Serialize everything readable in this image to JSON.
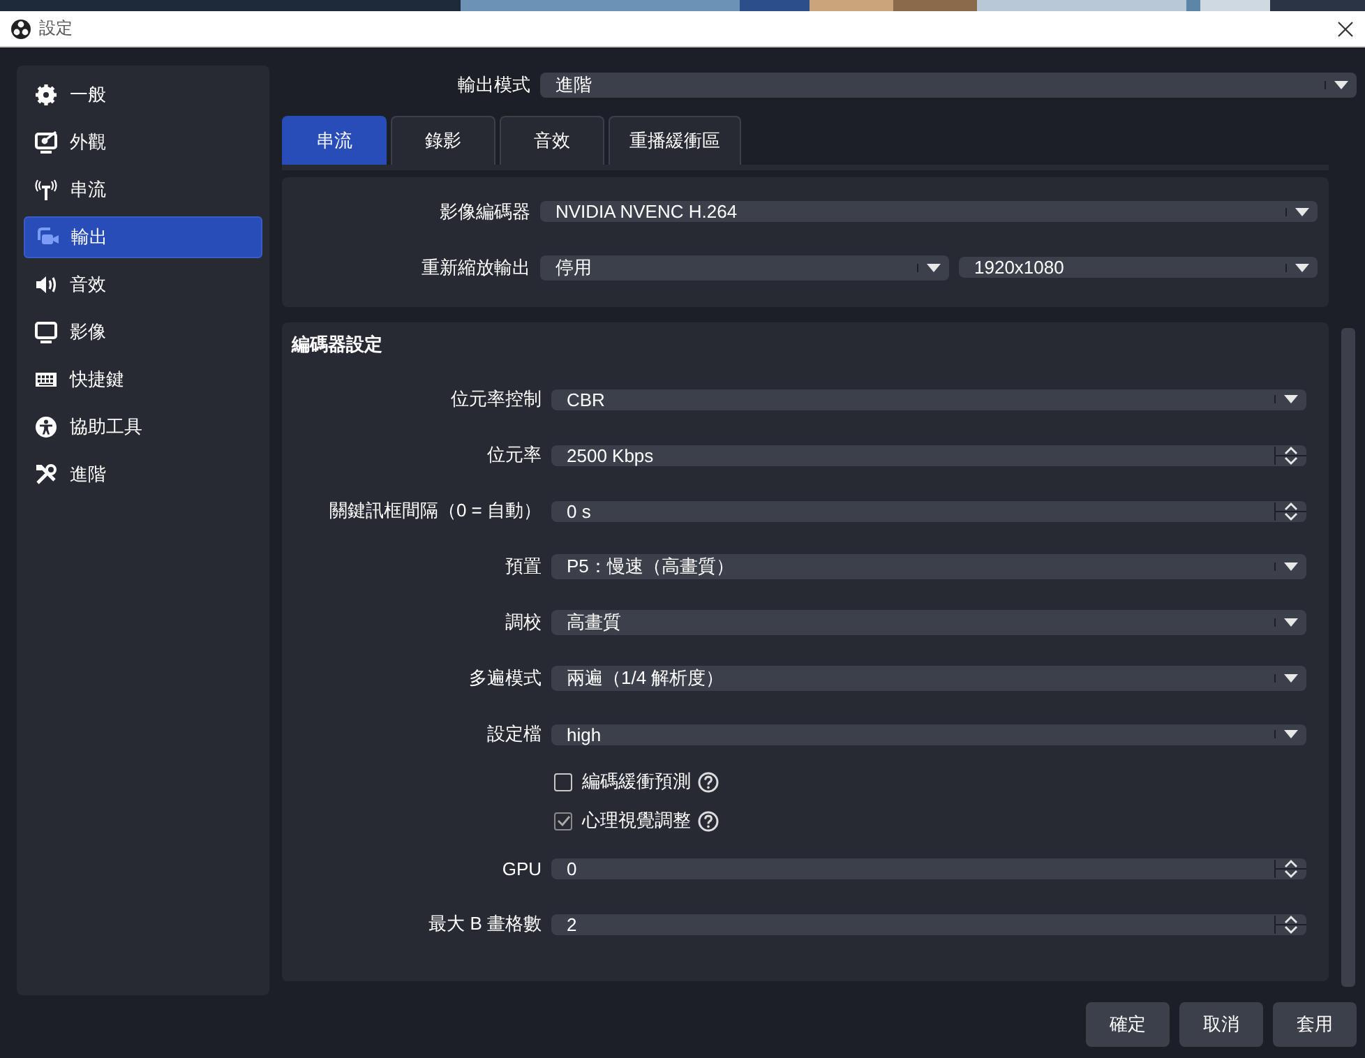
{
  "window": {
    "title": "設定"
  },
  "sidebar": {
    "items": [
      {
        "label": "一般",
        "kind": "gear",
        "selected": false
      },
      {
        "label": "外觀",
        "kind": "monitor-pen",
        "selected": false
      },
      {
        "label": "串流",
        "kind": "antenna",
        "selected": false
      },
      {
        "label": "輸出",
        "kind": "camera",
        "selected": true
      },
      {
        "label": "音效",
        "kind": "speaker",
        "selected": false
      },
      {
        "label": "影像",
        "kind": "monitor",
        "selected": false
      },
      {
        "label": "快捷鍵",
        "kind": "keyboard",
        "selected": false
      },
      {
        "label": "協助工具",
        "kind": "person",
        "selected": false
      },
      {
        "label": "進階",
        "kind": "tools",
        "selected": false
      }
    ]
  },
  "output_mode": {
    "label": "輸出模式",
    "value": "進階"
  },
  "tabs": [
    {
      "label": "串流",
      "selected": true
    },
    {
      "label": "錄影",
      "selected": false
    },
    {
      "label": "音效",
      "selected": false
    },
    {
      "label": "重播緩衝區",
      "selected": false
    }
  ],
  "encoder": {
    "label": "影像編碼器",
    "value": "NVIDIA NVENC H.264"
  },
  "rescale": {
    "label": "重新縮放輸出",
    "value": "停用",
    "resolution": "1920x1080"
  },
  "encoder_settings": {
    "title": "編碼器設定",
    "fields": [
      {
        "kind": "combo",
        "label": "位元率控制",
        "value": "CBR"
      },
      {
        "kind": "spin",
        "label": "位元率",
        "value": "2500 Kbps"
      },
      {
        "kind": "spin",
        "label": "關鍵訊框間隔（0 = 自動）",
        "value": "0 s"
      },
      {
        "kind": "combo",
        "label": "預置",
        "value": "P5：慢速（高畫質）"
      },
      {
        "kind": "combo",
        "label": "調校",
        "value": "高畫質"
      },
      {
        "kind": "combo",
        "label": "多遍模式",
        "value": "兩遍（1/4 解析度）"
      },
      {
        "kind": "combo",
        "label": "設定檔",
        "value": "high"
      },
      {
        "kind": "checkbox",
        "label": "編碼緩衝預測",
        "checked": false
      },
      {
        "kind": "checkbox",
        "label": "心理視覺調整",
        "checked": true
      },
      {
        "kind": "spin",
        "label": "GPU",
        "value": "0"
      },
      {
        "kind": "spin",
        "label": "最大 B 畫格數",
        "value": "2"
      }
    ]
  },
  "buttons": [
    "確定",
    "取消",
    "套用"
  ]
}
